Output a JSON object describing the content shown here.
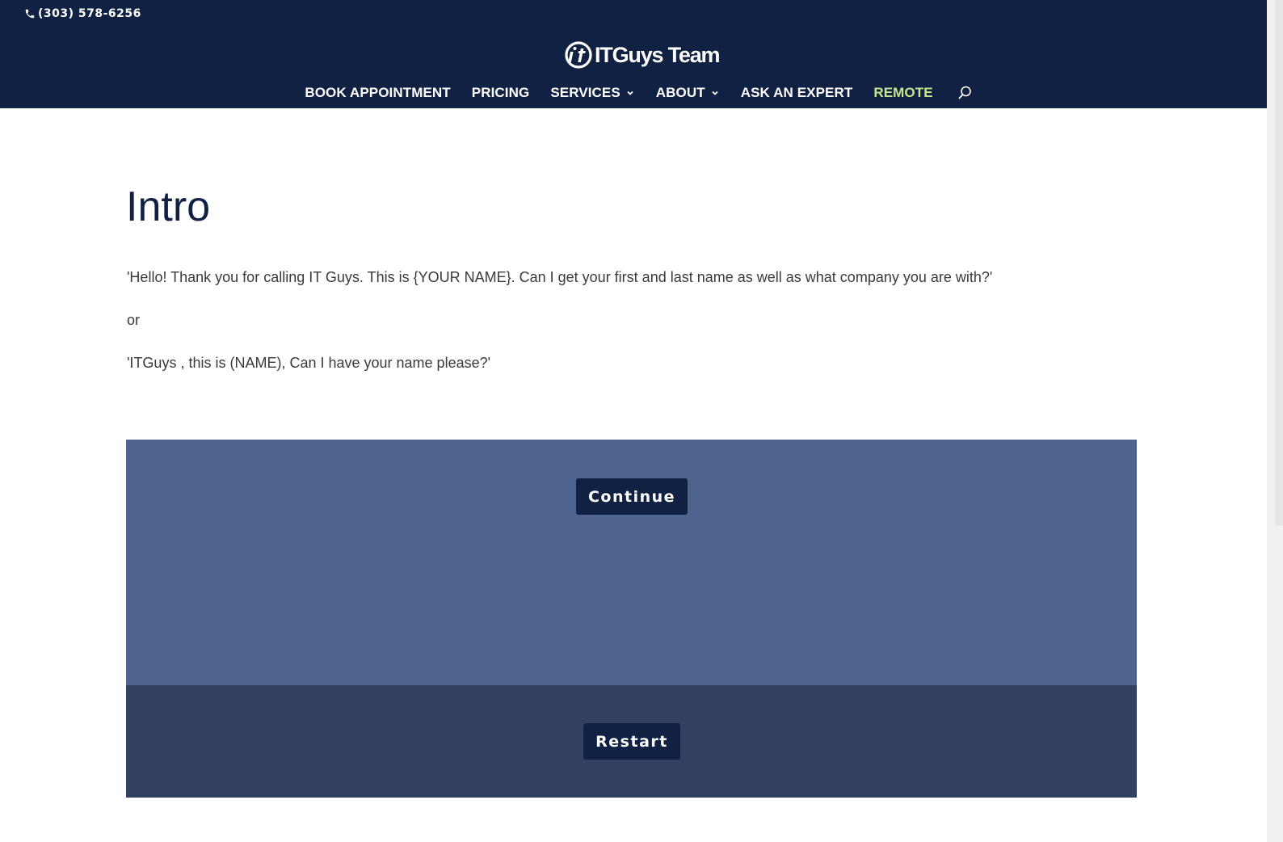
{
  "header": {
    "phone": "(303) 578-6256",
    "logo_text": "ITGuys Team",
    "nav": [
      {
        "label": "BOOK APPOINTMENT"
      },
      {
        "label": "PRICING"
      },
      {
        "label": "SERVICES"
      },
      {
        "label": "ABOUT"
      },
      {
        "label": "ASK AN EXPERT"
      },
      {
        "label": "REMOTE"
      }
    ],
    "colors": {
      "background": "#102143",
      "remote_accent": "#c9e48f"
    }
  },
  "main": {
    "title": "Intro",
    "paragraphs": [
      "'Hello! Thank you for calling IT Guys. This is {YOUR NAME}. Can I get your first and last name as well as what company you are with?'",
      "or",
      "'ITGuys , this is (NAME), Can I have your name please?'"
    ],
    "continue_label": "Continue",
    "restart_label": "Restart",
    "colors": {
      "continue_panel": "#4e648f",
      "restart_panel": "#32415f",
      "button": "#102143"
    }
  },
  "icons": {
    "phone": "phone-icon",
    "search": "search-icon",
    "dropdown": "chevron-down-icon"
  }
}
